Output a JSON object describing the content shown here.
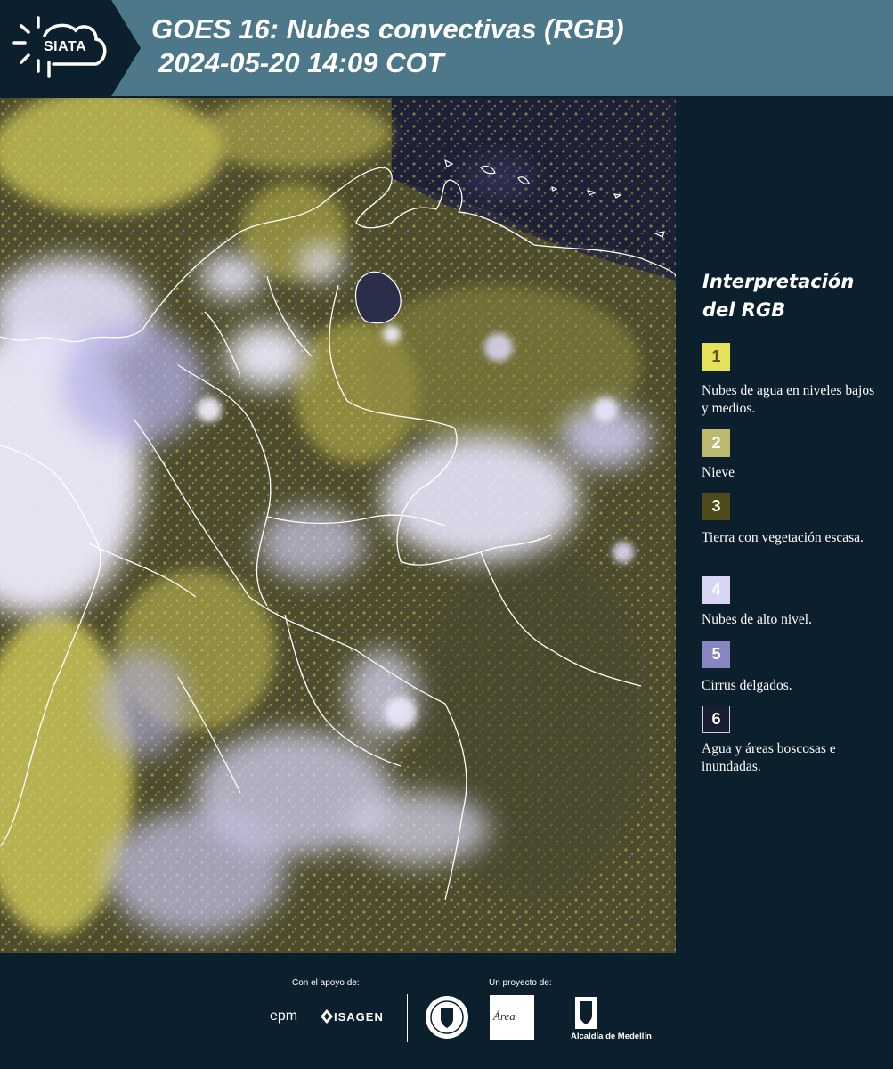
{
  "header": {
    "logo_text": "SIATA",
    "title_line1": "GOES 16: Nubes convectivas (RGB)",
    "title_line2": "2024-05-20 14:09 COT"
  },
  "legend": {
    "title": "Interpretación del RGB",
    "items": [
      {
        "number": "1",
        "label": "Nubes de agua en niveles bajos y medios.",
        "color": "#e6e15a"
      },
      {
        "number": "2",
        "label": "Nieve",
        "color": "#bdb870"
      },
      {
        "number": "3",
        "label": "Tierra con vegetación escasa.",
        "color": "#4f4a1c"
      },
      {
        "number": "4",
        "label": "Nubes de alto nivel.",
        "color": "#d8d6f4"
      },
      {
        "number": "5",
        "label": "Cirrus delgados.",
        "color": "#8886c0"
      },
      {
        "number": "6",
        "label": "Agua y áreas boscosas e inundadas.",
        "color": "#1b1d33"
      }
    ]
  },
  "footer": {
    "support_label": "Con el apoyo de:",
    "project_label": "Un proyecto de:",
    "epm_text": "epm",
    "isagen_text": "ISAGEN",
    "area_text": "Área",
    "alcaldia_text": "Alcaldía de Medellín"
  }
}
